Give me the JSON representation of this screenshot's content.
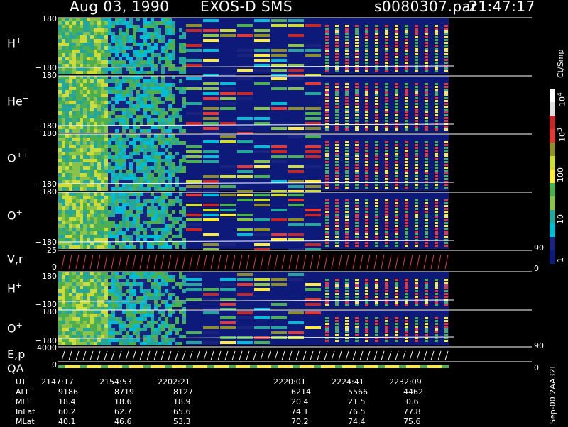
{
  "header": {
    "date": "Aug 03, 1990",
    "instrument": "EXOS-D SMS",
    "file": "s0080307.par",
    "time": "21:47:17"
  },
  "colorbar": {
    "unit": "Ct/Smp",
    "ticks": [
      "1",
      "10",
      "100",
      "10",
      "10"
    ],
    "tick_exps": [
      "",
      "",
      "",
      "3",
      "4"
    ]
  },
  "panels": [
    {
      "label": "H",
      "sup": "+",
      "top_tick": "180",
      "bottom_tick": "−180"
    },
    {
      "label": "He",
      "sup": "+",
      "top_tick": "180",
      "bottom_tick": "−180"
    },
    {
      "label": "O",
      "sup": "++",
      "top_tick": "180",
      "bottom_tick": "−180"
    },
    {
      "label": "O",
      "sup": "+",
      "top_tick": "180",
      "bottom_tick": "−180"
    },
    {
      "label": "V,r",
      "sup": "",
      "top_tick": "25",
      "bottom_tick": "0",
      "right_top": "90",
      "right_bottom": "0"
    },
    {
      "label": "H",
      "sup": "+",
      "top_tick": "180",
      "bottom_tick": "−180"
    },
    {
      "label": "O",
      "sup": "+",
      "top_tick": "180",
      "bottom_tick": "−180"
    },
    {
      "label": "E,p",
      "sup": "",
      "top_tick": "4000",
      "bottom_tick": "",
      "right_top": "90",
      "right_bottom": ""
    },
    {
      "label": "QA",
      "sup": "",
      "top_tick": "",
      "bottom_tick": "0",
      "right_top": "",
      "right_bottom": "0"
    }
  ],
  "footer": {
    "row_labels": [
      "UT",
      "ALT",
      "MLT",
      "InLat",
      "MLat"
    ],
    "columns": [
      [
        "2147:17",
        "9186",
        "18.4",
        "60.2",
        "40.1"
      ],
      [
        "2154:53",
        "8719",
        "18.6",
        "62.7",
        "46.6"
      ],
      [
        "2202:21",
        "8127",
        "18.9",
        "65.6",
        "53.3"
      ],
      [
        "2220:01",
        "6214",
        "20.4",
        "74.1",
        "70.2"
      ],
      [
        "2224:41",
        "5566",
        "21.5",
        "76.5",
        "74.4"
      ],
      [
        "2232:09",
        "4462",
        "0.6",
        "77.8",
        "75.6"
      ]
    ],
    "side_text": "Sep-00  2AA32L"
  },
  "chart_data": {
    "type": "heatmap",
    "title": "Aug 03, 1990   EXOS-D SMS",
    "panels": [
      "H+",
      "He+",
      "O++",
      "O+",
      "V,r",
      "H+",
      "O+",
      "E,p",
      "QA"
    ],
    "x_ticks": [
      "2147:17",
      "2154:53",
      "2202:21",
      "2220:01",
      "2224:41",
      "2232:09"
    ],
    "colorscale": {
      "unit": "Ct/Smp",
      "ticks": [
        1,
        10,
        100,
        1000,
        10000
      ]
    }
  }
}
